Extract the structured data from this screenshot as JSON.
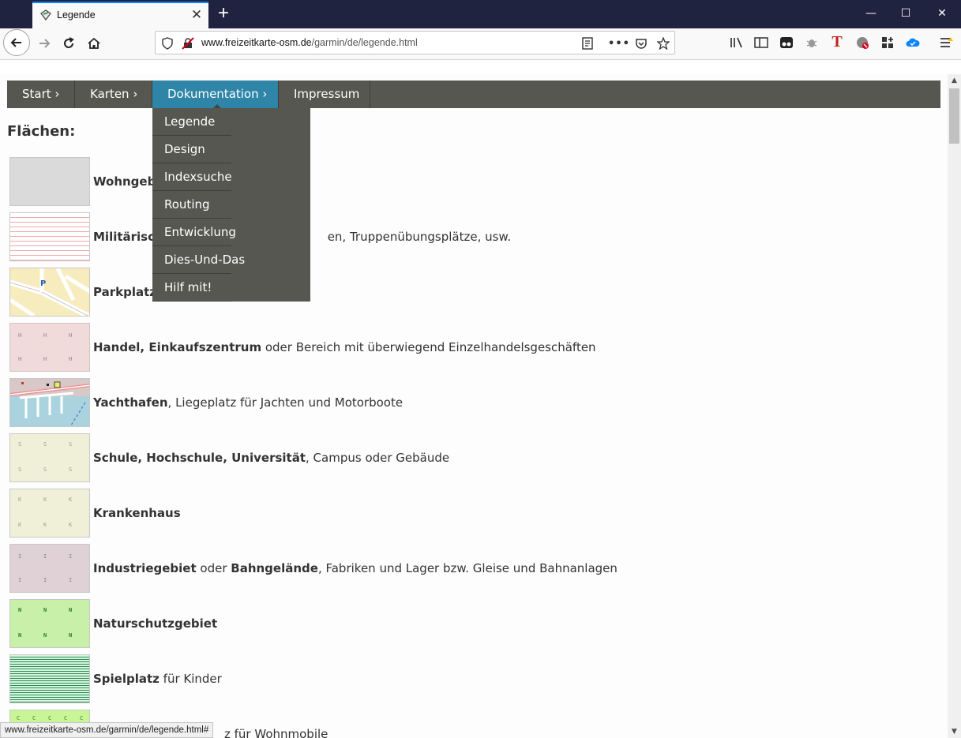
{
  "browser": {
    "tab_title": "Legende",
    "url_host": "www.freizeitkarte-osm.de",
    "url_path": "/garmin/de/legende.html",
    "status_url": "www.freizeitkarte-osm.de/garmin/de/legende.html#",
    "accent": "#0a84ff"
  },
  "menu": {
    "items": [
      "Start ›",
      "Karten ›",
      "Dokumentation ›",
      "Impressum"
    ],
    "active_index": 2,
    "dropdown": [
      "Legende",
      "Design",
      "Indexsuche",
      "Routing",
      "Entwicklung",
      "Dies-Und-Das",
      "Hilf mit!"
    ]
  },
  "section_title": "Flächen:",
  "legend": [
    {
      "bold1": "Wohngebi",
      "rest": ""
    },
    {
      "bold1": "Militärisch",
      "rest": "en, Truppenübungsplätze, usw."
    },
    {
      "bold1": "Parkplatz",
      "rest": ""
    },
    {
      "bold1": "Handel, Einkaufszentrum",
      "rest": " oder Bereich mit überwiegend Einzelhandelsgeschäften"
    },
    {
      "bold1": "Yachthafen",
      "rest": ", Liegeplatz für Jachten und Motorboote"
    },
    {
      "bold1": "Schule, Hochschule, Universität",
      "rest": ", Campus oder Gebäude"
    },
    {
      "bold1": "Krankenhaus",
      "rest": ""
    },
    {
      "bold1": "Industriegebiet",
      "mid": " oder ",
      "bold2": "Bahngelände",
      "rest": ", Fabriken und Lager bzw. Gleise und Bahnanlagen"
    },
    {
      "bold1": "Naturschutzgebiet",
      "rest": ""
    },
    {
      "bold1": "Spielplatz",
      "rest": " für Kinder"
    },
    {
      "bold1": "",
      "rest": "z für Wohnmobile"
    }
  ],
  "swatch_letters": {
    "handel": "H",
    "schule": "S",
    "krankenhaus": "K",
    "industrie": "I",
    "natur": "N",
    "camping": "C"
  },
  "colors": {
    "menu_bg": "#565751",
    "menu_active": "#2e85a8",
    "wohngebiet": "#dadada",
    "militaer_line": "#f0a8a8",
    "parkplatz": "#f7ecbe",
    "handel": "#f1dada",
    "yachthafen_water": "#aad3df",
    "schule": "#f0f0d8",
    "krankenhaus": "#f0f0d8",
    "industrie": "#dfd1d6",
    "natur": "#c8f0a8",
    "spielplatz_line": "#2b8b5c",
    "camping": "#c8f595"
  }
}
